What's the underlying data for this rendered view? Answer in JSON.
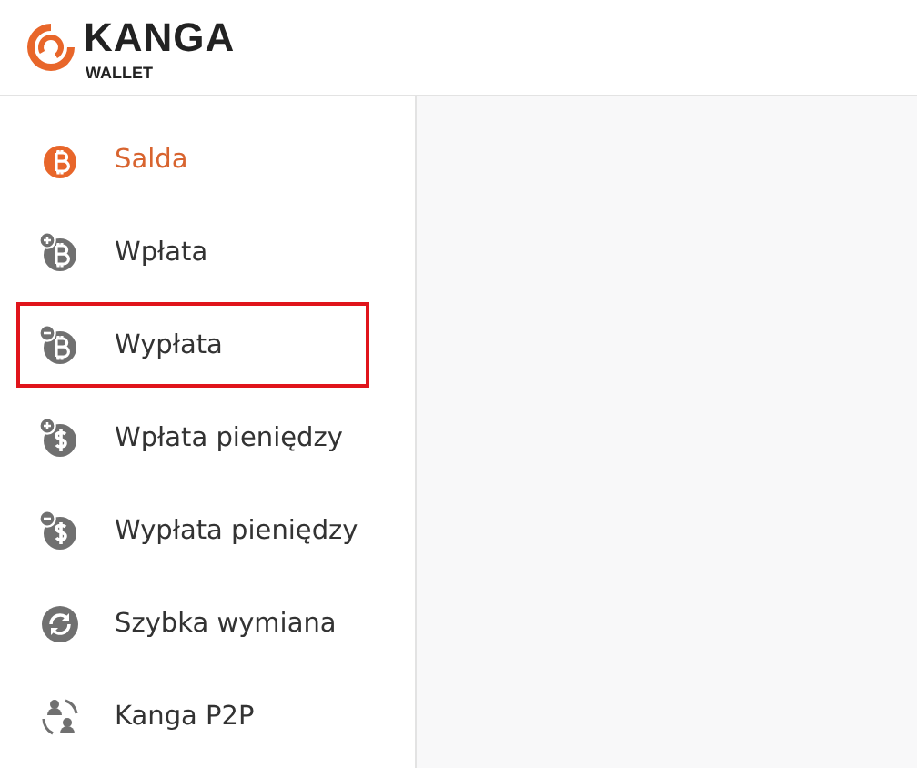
{
  "logo": {
    "name": "KANGA",
    "subtitle": "WALLET"
  },
  "sidebar": {
    "items": [
      {
        "label": "Salda",
        "kind": "btc",
        "selected": true,
        "highlighted": false
      },
      {
        "label": "Wpłata",
        "kind": "btc-plus",
        "selected": false,
        "highlighted": false
      },
      {
        "label": "Wypłata",
        "kind": "btc-minus",
        "selected": false,
        "highlighted": true
      },
      {
        "label": "Wpłata pieniędzy",
        "kind": "usd-plus",
        "selected": false,
        "highlighted": false
      },
      {
        "label": "Wypłata pieniędzy",
        "kind": "usd-minus",
        "selected": false,
        "highlighted": false
      },
      {
        "label": "Szybka wymiana",
        "kind": "exchange",
        "selected": false,
        "highlighted": false
      },
      {
        "label": "Kanga P2P",
        "kind": "p2p",
        "selected": false,
        "highlighted": false
      }
    ]
  }
}
